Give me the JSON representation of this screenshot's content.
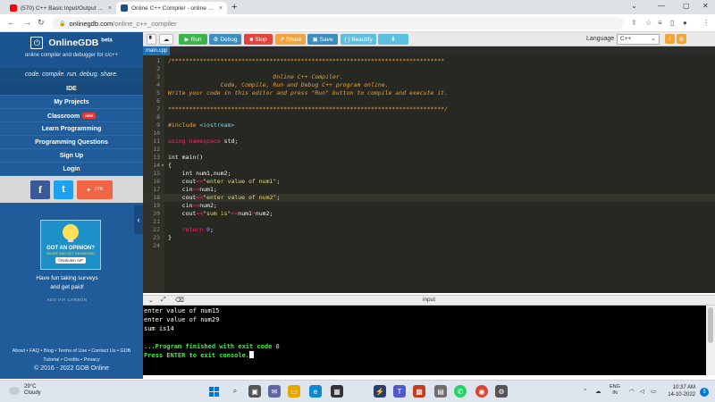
{
  "browser": {
    "tabs": [
      {
        "title": "(570) C++ Basic Input/Output & ...",
        "close": "×"
      },
      {
        "title": "Online C++ Compiler - online ed...",
        "close": "×"
      }
    ],
    "new_tab": "+",
    "url_host": "onlinegdb.com",
    "url_path": "/online_c++_compiler",
    "window_controls": {
      "minimize": "—",
      "maximize": "▢",
      "close": "✕",
      "chevron": "⌄"
    }
  },
  "sidebar": {
    "brand": "OnlineGDB",
    "beta": "beta",
    "subtitle": "online compiler and debugger for c/c++",
    "tagline": "code. compile. run. debug. share.",
    "menu": [
      {
        "label": "IDE"
      },
      {
        "label": "My Projects"
      },
      {
        "label": "Classroom",
        "badge": "new"
      },
      {
        "label": "Learn Programming"
      },
      {
        "label": "Programming Questions"
      },
      {
        "label": "Sign Up"
      },
      {
        "label": "Login"
      }
    ],
    "share": {
      "facebook": "f",
      "twitter": "t",
      "plus": "+",
      "count": "77K"
    },
    "ad": {
      "title": "GOT AN OPINION?",
      "subtitle": "SHARE AND GET REWARDED",
      "brand": "©Rakuten AIP",
      "text_line1": "Have fun taking surveys",
      "text_line2": "and get paid!",
      "via": "ADS VIA CARBON"
    },
    "footer": {
      "links": "About • FAQ • Blog • Terms of Use • Contact Us • GDB",
      "links2": "Tutorial • Credits • Privacy",
      "copyright": "© 2016 - 2022 GDB Online"
    }
  },
  "toolbar": {
    "run": "Run",
    "debug": "Debug",
    "stop": "Stop",
    "share": "Share",
    "save": "Save",
    "beautify": "{ } Beautify",
    "language_label": "Language",
    "language_value": "C++"
  },
  "file_tab": "main.cpp",
  "editor": {
    "active_line": 18,
    "lines": [
      {
        "n": "1",
        "parts": [
          [
            "comment",
            "/******************************************************************************"
          ]
        ]
      },
      {
        "n": "2",
        "parts": []
      },
      {
        "n": "3",
        "parts": [
          [
            "comment",
            "                              Online C++ Compiler."
          ]
        ]
      },
      {
        "n": "4",
        "parts": [
          [
            "comment",
            "               Code, Compile, Run and Debug C++ program online."
          ]
        ]
      },
      {
        "n": "5",
        "parts": [
          [
            "comment",
            "Write your code in this editor and press \"Run\" button to compile and execute it."
          ]
        ]
      },
      {
        "n": "6",
        "parts": []
      },
      {
        "n": "7",
        "parts": [
          [
            "comment",
            "*******************************************************************************/"
          ]
        ]
      },
      {
        "n": "8",
        "parts": []
      },
      {
        "n": "9",
        "parts": [
          [
            "preproc",
            "#include "
          ],
          [
            "include",
            "<iostream>"
          ]
        ]
      },
      {
        "n": "10",
        "parts": []
      },
      {
        "n": "11",
        "parts": [
          [
            "keyword",
            "using namespace "
          ],
          [
            "plain",
            "std;"
          ]
        ]
      },
      {
        "n": "12",
        "parts": []
      },
      {
        "n": "13",
        "parts": [
          [
            "plain",
            "int main()"
          ]
        ]
      },
      {
        "n": "14",
        "fold": "▾",
        "parts": [
          [
            "plain",
            "{"
          ]
        ]
      },
      {
        "n": "15",
        "parts": [
          [
            "plain",
            "    int num1,num2;"
          ]
        ]
      },
      {
        "n": "16",
        "parts": [
          [
            "plain",
            "    cout"
          ],
          [
            "op",
            "<<"
          ],
          [
            "string",
            "\"enter value of num1\""
          ],
          [
            "plain",
            ";"
          ]
        ]
      },
      {
        "n": "17",
        "parts": [
          [
            "plain",
            "    cin"
          ],
          [
            "op",
            ">>"
          ],
          [
            "plain",
            "num1;"
          ]
        ]
      },
      {
        "n": "18",
        "parts": [
          [
            "plain",
            "    cout"
          ],
          [
            "op",
            "<<"
          ],
          [
            "string",
            "\"enter value of num2\""
          ],
          [
            "plain",
            ";"
          ]
        ]
      },
      {
        "n": "19",
        "parts": [
          [
            "plain",
            "    cin"
          ],
          [
            "op",
            ">>"
          ],
          [
            "plain",
            "num2;"
          ]
        ]
      },
      {
        "n": "20",
        "parts": [
          [
            "plain",
            "    cout"
          ],
          [
            "op",
            "<<"
          ],
          [
            "string",
            "\"sum is\""
          ],
          [
            "op",
            "<<"
          ],
          [
            "plain",
            "num1"
          ],
          [
            "op",
            "+"
          ],
          [
            "plain",
            "num2;"
          ]
        ]
      },
      {
        "n": "21",
        "parts": []
      },
      {
        "n": "22",
        "parts": [
          [
            "keyword",
            "    return "
          ],
          [
            "number",
            "0"
          ],
          [
            "plain",
            ";"
          ]
        ]
      },
      {
        "n": "23",
        "parts": [
          [
            "plain",
            "}"
          ]
        ]
      },
      {
        "n": "24",
        "parts": []
      }
    ]
  },
  "io": {
    "title": "input",
    "console_lines": [
      {
        "text": "enter value of num15",
        "style": "plain"
      },
      {
        "text": "enter value of num29",
        "style": "plain"
      },
      {
        "text": "sum is14",
        "style": "plain"
      },
      {
        "text": "",
        "style": "plain"
      },
      {
        "text": "...Program finished with exit code 0",
        "style": "green"
      },
      {
        "text": "Press ENTER to exit console.",
        "style": "green",
        "cursor": true
      }
    ]
  },
  "taskbar": {
    "temp": "29°C",
    "weather": "Cloudy",
    "lang1": "ENG",
    "lang2": "IN",
    "time": "10:37 AM",
    "date": "14-10-2022",
    "notifications": "3"
  },
  "colors": {
    "sidebar": "#1f5c99",
    "run": "#3cb44b",
    "stop": "#e0443c",
    "share": "#f0a640",
    "editor_bg": "#272822",
    "console_text": "#3ff23f"
  }
}
